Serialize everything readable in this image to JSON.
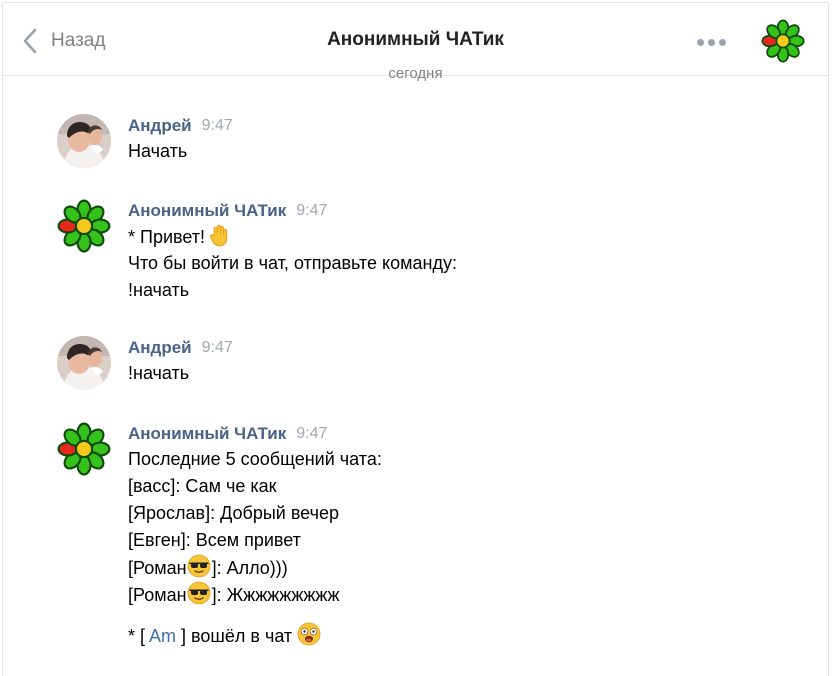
{
  "header": {
    "back_label": "Назад",
    "title": "Анонимный ЧАТик"
  },
  "day_separator": "сегодня",
  "messages": [
    {
      "author": "Андрей",
      "time": "9:47",
      "avatar": "user-photo",
      "lines": [
        "Начать"
      ]
    },
    {
      "author": "Анонимный ЧАТик",
      "time": "9:47",
      "avatar": "icq-flower-icon",
      "greeting": "* Привет!",
      "greeting_emoji": "raised-hand-emoji",
      "lines": [
        "Что бы войти в чат, отправьте команду:",
        "!начать"
      ]
    },
    {
      "author": "Андрей",
      "time": "9:47",
      "avatar": "user-photo",
      "lines": [
        "!начать"
      ]
    },
    {
      "author": "Анонимный ЧАТик",
      "time": "9:47",
      "avatar": "icq-flower-icon",
      "lines": [
        "Последние 5 сообщений чата:",
        "[васс]: Сам че как",
        "[Ярослав]: Добрый вечер",
        "[Евген]: Всем привет"
      ],
      "emoji_lines": [
        {
          "before": "[Роман",
          "emoji": "sunglasses-emoji",
          "after": "]: Алло)))"
        },
        {
          "before": "[Роман",
          "emoji": "sunglasses-emoji",
          "after": "]: Жжжжжжжжж"
        }
      ],
      "join_notice": {
        "prefix": "* [",
        "user": "Am",
        "suffix": "] вошёл в чат",
        "emoji": "astonished-emoji"
      }
    }
  ],
  "colors": {
    "author": "#4a6287",
    "time": "#a1a7b0",
    "link": "#3f6fa8",
    "muted": "#828282",
    "icq_petal": "#35c21b",
    "icq_red_petal": "#e8281d"
  }
}
